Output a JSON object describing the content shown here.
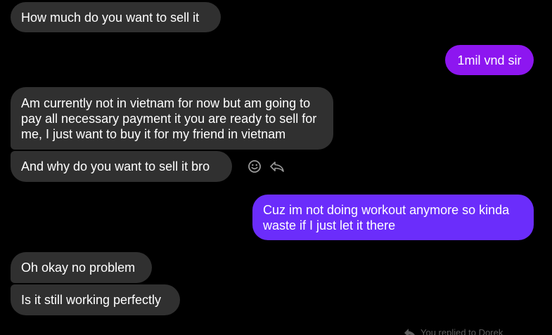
{
  "messages": [
    {
      "id": "m1",
      "direction": "incoming",
      "text": "How much do you want to sell it"
    },
    {
      "id": "m2",
      "direction": "outgoing",
      "text": "1mil vnd sir"
    },
    {
      "id": "m3",
      "direction": "incoming",
      "text": "Am currently not in vietnam for now but am going to pay all necessary payment it you are ready to sell for me, I just want to buy it for my friend in vietnam"
    },
    {
      "id": "m4",
      "direction": "incoming",
      "text": "And why do you want to sell it bro"
    },
    {
      "id": "m5",
      "direction": "outgoing",
      "text": "Cuz im not doing workout anymore so kinda waste if I just let it there"
    },
    {
      "id": "m6",
      "direction": "incoming",
      "text": "Oh okay no problem"
    },
    {
      "id": "m7",
      "direction": "incoming",
      "text": "Is it still working perfectly"
    }
  ],
  "actions": {
    "react_icon": "smiley-face-icon",
    "reply_icon": "reply-arrow-icon"
  },
  "reply_hint": {
    "text": "You replied to Dorek",
    "icon": "reply-arrow-icon"
  },
  "colors": {
    "background": "#000000",
    "incoming_bubble": "#303030",
    "outgoing_bubble_1": "#8d16f0",
    "outgoing_bubble_2": "#6b2dfb",
    "text": "#ffffff",
    "icon": "#9a9a9a"
  }
}
